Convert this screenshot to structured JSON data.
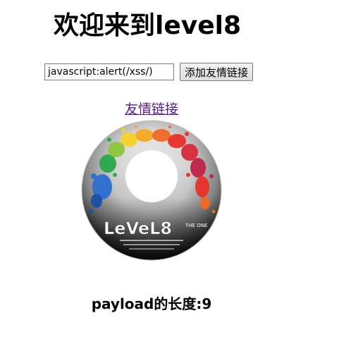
{
  "page": {
    "heading": "欢迎来到level8"
  },
  "form": {
    "input_value": "javascript:alert(/xss/)",
    "submit_label": "添加友情链接"
  },
  "link": {
    "text": "友情链接"
  },
  "image": {
    "logo_text": "LeVeL8",
    "logo_subtext": "THE ONE"
  },
  "footer": {
    "payload_label": "payload的长度:",
    "payload_length": "9"
  },
  "colors": {
    "link": "#551a8b",
    "text": "#000000",
    "background": "#ffffff"
  }
}
